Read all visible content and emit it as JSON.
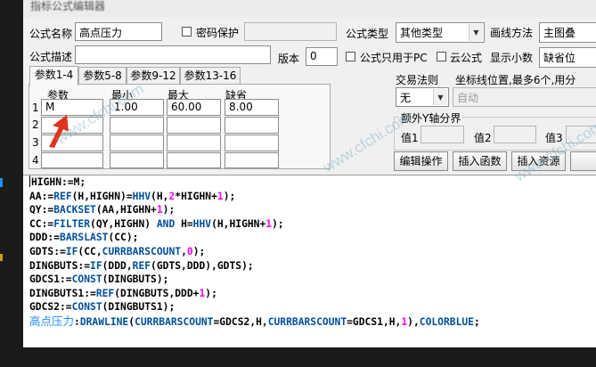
{
  "window": {
    "title": "指标公式编辑器"
  },
  "form": {
    "name_label": "公式名称",
    "name_value": "高点压力",
    "password_label": "密码保护",
    "type_label": "公式类型",
    "type_value": "其他类型",
    "draw_method_label": "画线方法",
    "draw_method_value": "主图叠",
    "desc_label": "公式描述",
    "version_label": "版本",
    "version_value": "0",
    "pc_only_label": "公式只用于PC",
    "cloud_label": "云公式",
    "decimals_label": "显示小数",
    "decimals_value": "缺省位"
  },
  "tabs": [
    {
      "label": "参数1-4"
    },
    {
      "label": "参数5-8"
    },
    {
      "label": "参数9-12"
    },
    {
      "label": "参数13-16"
    }
  ],
  "params": {
    "headers": {
      "name": "参数",
      "min": "最小",
      "max": "最大",
      "default": "缺省"
    },
    "rows": [
      {
        "index": "1",
        "name": "M",
        "min": "1.00",
        "max": "60.00",
        "default": "8.00"
      },
      {
        "index": "2",
        "name": "",
        "min": "",
        "max": "",
        "default": ""
      },
      {
        "index": "3",
        "name": "",
        "min": "",
        "max": "",
        "default": ""
      },
      {
        "index": "4",
        "name": "",
        "min": "",
        "max": "",
        "default": ""
      }
    ]
  },
  "trade": {
    "label": "交易法则",
    "value": "无"
  },
  "coord": {
    "label": "坐标线位置,最多6个,用分",
    "value": "自动"
  },
  "yaxis": {
    "label": "额外Y轴分界",
    "v1": "值1",
    "v2": "值2",
    "v3": "值3"
  },
  "buttons": {
    "edit": "编辑操作",
    "insert_func": "插入函数",
    "insert_res": "插入资源"
  },
  "watermark": "www.cfchi.com",
  "code": {
    "line1": "HIGHN:=M;",
    "line2": {
      "a": "AA:=",
      "b": "REF",
      "c": "(H,HIGHN)=",
      "d": "HHV",
      "e": "(H,",
      "f": "2",
      "g": "*HIGHN+",
      "h": "1",
      "i": ");"
    },
    "line3": {
      "a": "QY:=",
      "b": "BACKSET",
      "c": "(AA,HIGHN+",
      "d": "1",
      "e": ");"
    },
    "line4": {
      "a": "CC:=",
      "b": "FILTER",
      "c": "(QY,HIGHN) ",
      "d": "AND",
      "e": " H=",
      "f": "HHV",
      "g": "(H,HIGHN+",
      "h": "1",
      "i": ");"
    },
    "line5": {
      "a": "DDD:=",
      "b": "BARSLAST",
      "c": "(CC);"
    },
    "line6": {
      "a": "GDTS:=",
      "b": "IF",
      "c": "(CC,",
      "d": "CURRBARSCOUNT",
      "e": ",",
      "f": "0",
      "g": ");"
    },
    "line7": {
      "a": "DINGBUTS:=",
      "b": "IF",
      "c": "(DDD,",
      "d": "REF",
      "e": "(GDTS,DDD),GDTS);"
    },
    "line8": {
      "a": "GDCS1:=",
      "b": "CONST",
      "c": "(DINGBUTS);"
    },
    "line9": {
      "a": "DINGBUTS1:=",
      "b": "REF",
      "c": "(DINGBUTS,DDD+",
      "d": "1",
      "e": ");"
    },
    "line10": {
      "a": "GDCS2:=",
      "b": "CONST",
      "c": "(DINGBUTS1);"
    },
    "line11": {
      "a": "高点压力",
      "b": ":",
      "c": "DRAWLINE",
      "d": "(",
      "e": "CURRBARSCOUNT",
      "f": "=GDCS2,H,",
      "g": "CURRBARSCOUNT",
      "h": "=GDCS1,H,",
      "i": "1",
      "j": "),",
      "k": "COLORBLUE",
      "l": ";"
    }
  }
}
